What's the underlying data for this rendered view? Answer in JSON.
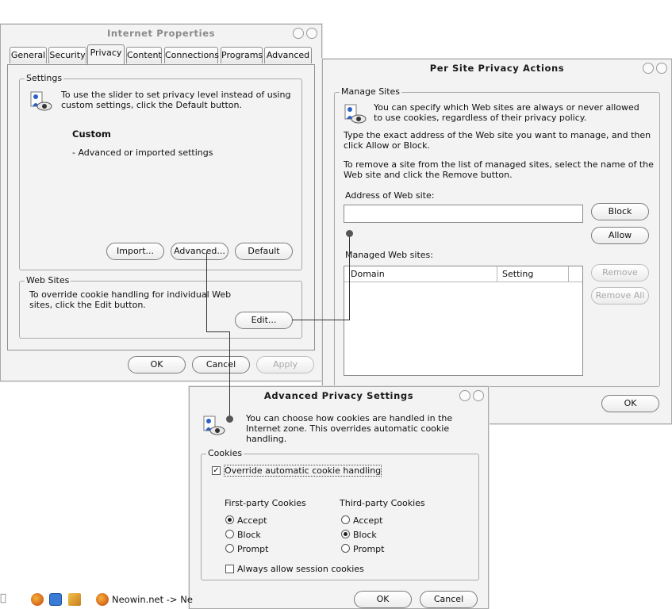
{
  "internet_properties": {
    "title": "Internet Properties",
    "tabs": [
      "General",
      "Security",
      "Privacy",
      "Content",
      "Connections",
      "Programs",
      "Advanced"
    ],
    "settings_legend": "Settings",
    "settings_text": "To use the slider to set privacy level instead of using custom settings, click the Default button.",
    "level_title": "Custom",
    "level_desc": "- Advanced or imported settings",
    "import_btn": "Import...",
    "advanced_btn": "Advanced...",
    "default_btn": "Default",
    "websites_legend": "Web Sites",
    "websites_text": "To override cookie handling for individual Web sites, click the Edit button.",
    "edit_btn": "Edit...",
    "ok_btn": "OK",
    "cancel_btn": "Cancel",
    "apply_btn": "Apply"
  },
  "per_site": {
    "title": "Per Site Privacy Actions",
    "manage_legend": "Manage Sites",
    "intro": "You can specify which Web sites are always or never allowed to use cookies, regardless of their privacy policy.",
    "type_text": "Type the exact address of the Web site you want to manage, and then click Allow or Block.",
    "remove_text": "To remove a site from the list of managed sites, select the name of the Web site and click the Remove button.",
    "address_label": "Address of Web site:",
    "address_value": "",
    "block_btn": "Block",
    "allow_btn": "Allow",
    "managed_label": "Managed Web sites:",
    "col_domain": "Domain",
    "col_setting": "Setting",
    "remove_btn": "Remove",
    "remove_all_btn": "Remove All",
    "ok_btn": "OK"
  },
  "advanced_privacy": {
    "title": "Advanced Privacy Settings",
    "intro": "You can choose how cookies are handled in the Internet zone.  This overrides automatic cookie handling.",
    "cookies_legend": "Cookies",
    "override_label": "Override automatic cookie handling",
    "override_checked": true,
    "first_party_label": "First-party Cookies",
    "third_party_label": "Third-party Cookies",
    "first_party": {
      "accept": "Accept",
      "block": "Block",
      "prompt": "Prompt",
      "selected": "accept"
    },
    "third_party": {
      "accept": "Accept",
      "block": "Block",
      "prompt": "Prompt",
      "selected": "block"
    },
    "session_label": "Always allow session cookies",
    "session_checked": false,
    "ok_btn": "OK",
    "cancel_btn": "Cancel"
  },
  "taskbar": {
    "item_label": "Neowin.net -> Ne"
  }
}
